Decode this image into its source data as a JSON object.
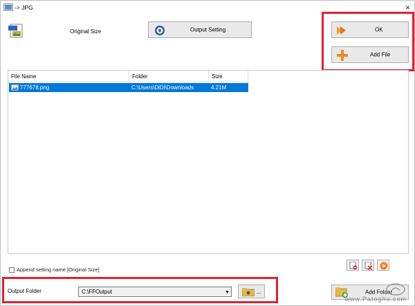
{
  "window": {
    "title": "-> JPG",
    "close_glyph": "×",
    "icon": "app-icon"
  },
  "toolbar": {
    "original_size_label": "Original Size",
    "output_setting_label": "Output Setting",
    "ok_label": "OK",
    "add_file_label": "Add File"
  },
  "file_list": {
    "columns": [
      "File Name",
      "Folder",
      "Size"
    ],
    "rows": [
      {
        "name": "777678.png",
        "folder": "C:\\Users\\DiDi\\Downloads",
        "size": "4.21M",
        "selected": true
      }
    ]
  },
  "options": {
    "append_setting_label": "Append setting name [Original Size]",
    "append_checked": false
  },
  "output": {
    "label": "Output Folder",
    "folder_value": "C:\\FFOutput",
    "browse_label": "...",
    "add_folder_label": "Add Folder"
  },
  "watermark": {
    "text": "www.Patoghu.com"
  },
  "colors": {
    "highlight": "#e02030",
    "selection": "#0078d7"
  }
}
